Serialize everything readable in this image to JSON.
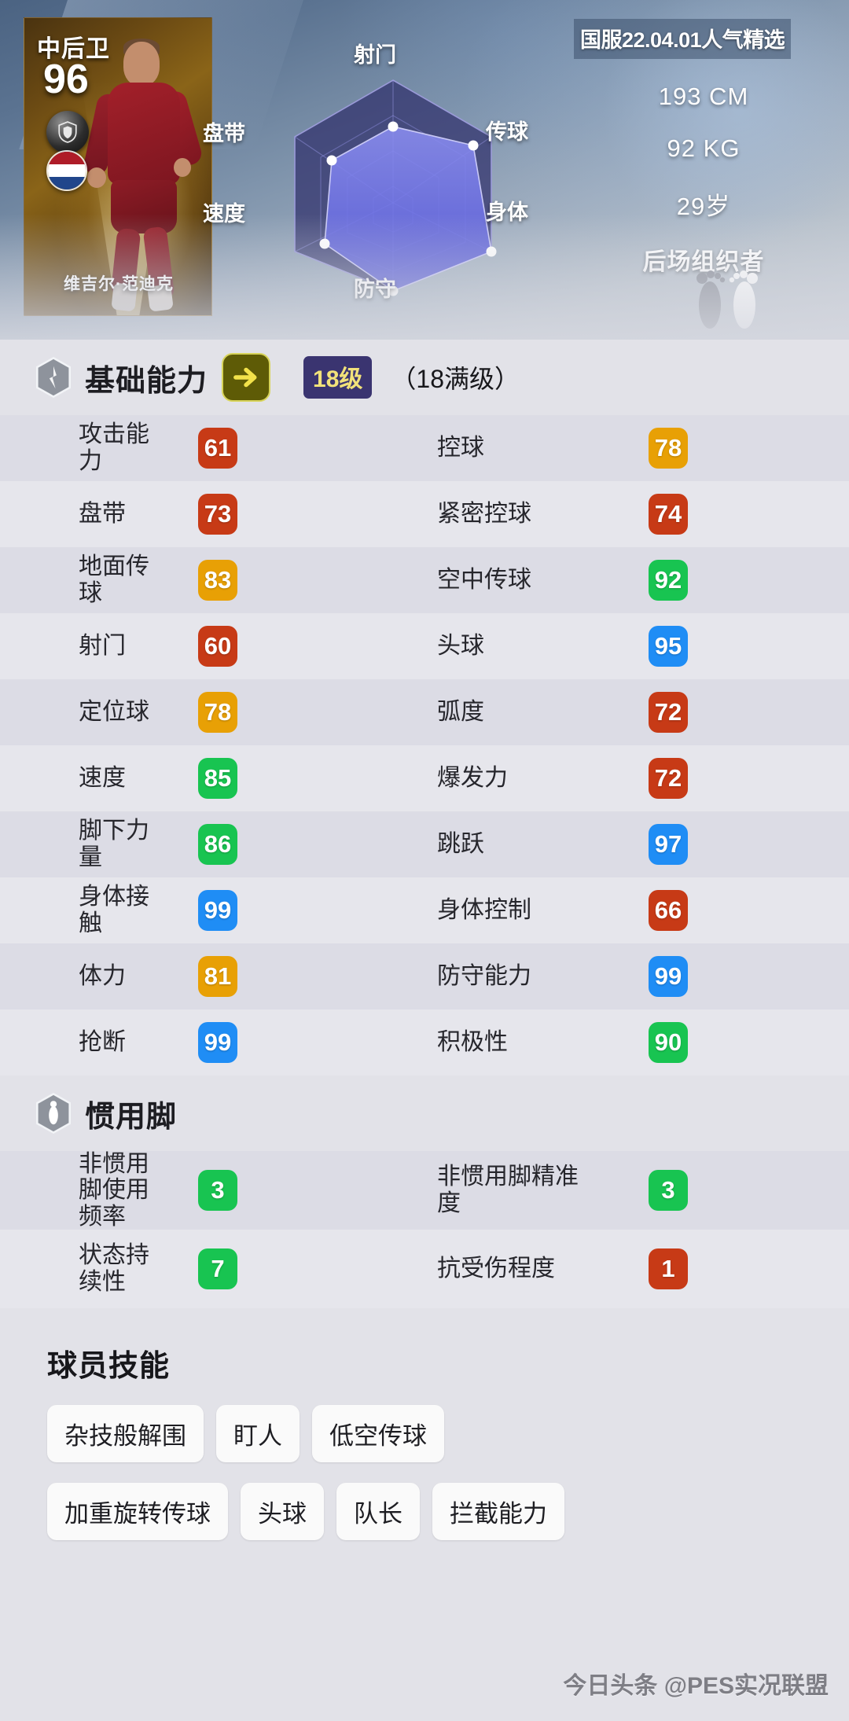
{
  "card": {
    "position": "中后卫",
    "rating": "96",
    "player_name": "维吉尔·范迪克",
    "nation": "Netherlands"
  },
  "radar": {
    "labels": {
      "top": "射门",
      "top_left": "盘带",
      "top_right": "传球",
      "bottom_left": "速度",
      "bottom_right": "身体",
      "bottom": "防守"
    }
  },
  "info": {
    "banner": "国服22.04.01人气精选",
    "height": "193 CM",
    "weight": "92 KG",
    "age": "29岁",
    "role": "后场组织者"
  },
  "basic_section": {
    "title": "基础能力",
    "level_badge": "18级",
    "level_max": "（18满级）"
  },
  "basic_stats": [
    [
      {
        "label": "攻击能力",
        "value": "61",
        "color": "red"
      },
      {
        "label": "控球",
        "value": "78",
        "color": "orange"
      }
    ],
    [
      {
        "label": "盘带",
        "value": "73",
        "color": "red"
      },
      {
        "label": "紧密控球",
        "value": "74",
        "color": "red"
      }
    ],
    [
      {
        "label": "地面传球",
        "value": "83",
        "color": "orange"
      },
      {
        "label": "空中传球",
        "value": "92",
        "color": "green"
      }
    ],
    [
      {
        "label": "射门",
        "value": "60",
        "color": "red"
      },
      {
        "label": "头球",
        "value": "95",
        "color": "blue"
      }
    ],
    [
      {
        "label": "定位球",
        "value": "78",
        "color": "orange"
      },
      {
        "label": "弧度",
        "value": "72",
        "color": "red"
      }
    ],
    [
      {
        "label": "速度",
        "value": "85",
        "color": "green"
      },
      {
        "label": "爆发力",
        "value": "72",
        "color": "red"
      }
    ],
    [
      {
        "label": "脚下力量",
        "value": "86",
        "color": "green"
      },
      {
        "label": "跳跃",
        "value": "97",
        "color": "blue"
      }
    ],
    [
      {
        "label": "身体接触",
        "value": "99",
        "color": "blue"
      },
      {
        "label": "身体控制",
        "value": "66",
        "color": "red"
      }
    ],
    [
      {
        "label": "体力",
        "value": "81",
        "color": "orange"
      },
      {
        "label": "防守能力",
        "value": "99",
        "color": "blue"
      }
    ],
    [
      {
        "label": "抢断",
        "value": "99",
        "color": "blue"
      },
      {
        "label": "积极性",
        "value": "90",
        "color": "green"
      }
    ]
  ],
  "foot_section": {
    "title": "惯用脚"
  },
  "foot_stats": [
    [
      {
        "label": "非惯用脚使用频率",
        "value": "3",
        "color": "green"
      },
      {
        "label": "非惯用脚精准度",
        "value": "3",
        "color": "green"
      }
    ],
    [
      {
        "label": "状态持续性",
        "value": "7",
        "color": "green"
      },
      {
        "label": "抗受伤程度",
        "value": "1",
        "color": "red"
      }
    ]
  ],
  "skills": {
    "title": "球员技能",
    "row1": [
      "杂技般解围",
      "盯人",
      "低空传球"
    ],
    "row2": [
      "加重旋转传球",
      "头球",
      "队长",
      "拦截能力"
    ]
  },
  "watermark": "今日头条 @PES实况联盟",
  "colors": {
    "blue": "#1f8df5",
    "green": "#18c451",
    "orange": "#e8a005",
    "red": "#c73a16",
    "level_badge_bg": "#3a3470",
    "arrow_bg": "#5e5b06"
  },
  "chart_data": {
    "type": "radar",
    "title": "",
    "categories": [
      "射门",
      "传球",
      "身体",
      "防守",
      "速度",
      "盘带"
    ],
    "values": [
      62,
      82,
      100,
      100,
      72,
      68
    ],
    "max": 100,
    "series": [
      {
        "name": "能力值",
        "values": [
          62,
          82,
          100,
          100,
          72,
          68
        ]
      }
    ],
    "grid": true,
    "legend": "none"
  }
}
